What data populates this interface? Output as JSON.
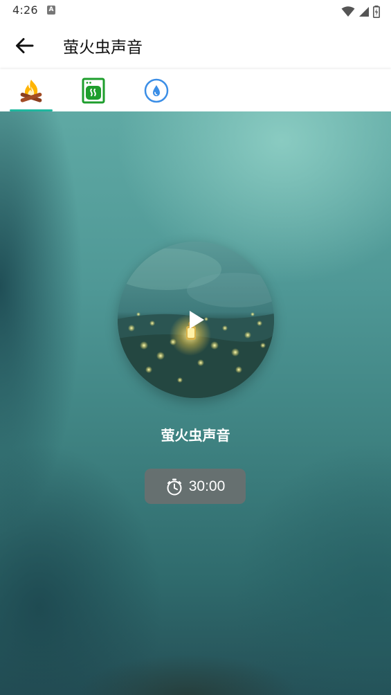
{
  "status_bar": {
    "time": "4:26",
    "notification_icon": "a-letter-icon",
    "icons": [
      "wifi-icon",
      "signal-icon",
      "battery-charging-icon"
    ]
  },
  "app_bar": {
    "back_icon": "arrow-left-icon",
    "title": "萤火虫声音"
  },
  "tabs": [
    {
      "icon": "campfire-icon",
      "selected": true
    },
    {
      "icon": "washing-machine-icon",
      "selected": false
    },
    {
      "icon": "water-drop-icon",
      "selected": false
    }
  ],
  "colors": {
    "tab_indicator": "#1fb89f",
    "washer_icon": "#1e9e2c",
    "drop_icon": "#3b8ee6"
  },
  "player": {
    "track_title": "萤火虫声音",
    "play_icon": "play-icon",
    "timer_icon": "stopwatch-icon",
    "timer_value": "30:00"
  }
}
